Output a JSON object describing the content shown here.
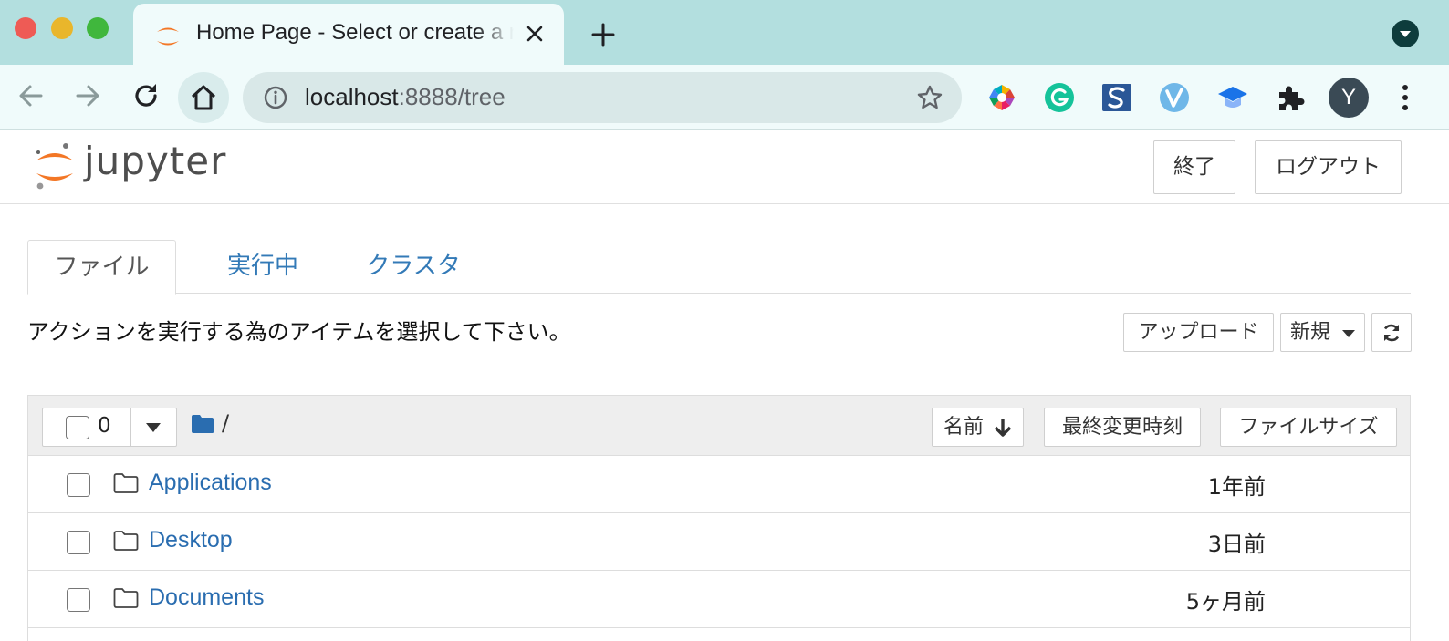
{
  "browser": {
    "tab_title": "Home Page - Select or create a notebook",
    "url_host": "localhost",
    "url_rest": ":8888/tree",
    "avatar_letter": "Y",
    "icons": [
      "back-icon",
      "forward-icon",
      "reload-icon",
      "home-icon",
      "info-icon",
      "bookmark-star-icon",
      "extension-icon",
      "kebab-menu-icon"
    ]
  },
  "header": {
    "logo_text": "jupyter",
    "quit_label": "終了",
    "logout_label": "ログアウト"
  },
  "tabs": [
    {
      "label": "ファイル",
      "active": true
    },
    {
      "label": "実行中",
      "active": false
    },
    {
      "label": "クラスタ",
      "active": false
    }
  ],
  "instructions": "アクションを実行する為のアイテムを選択して下さい。",
  "actions": {
    "upload_label": "アップロード",
    "new_label": "新規"
  },
  "list": {
    "selected_count": "0",
    "breadcrumb": "/",
    "sort_name_label": "名前",
    "sort_modified_label": "最終変更時刻",
    "sort_size_label": "ファイルサイズ",
    "rows": [
      {
        "name": "Applications",
        "modified": "1年前"
      },
      {
        "name": "Desktop",
        "modified": "3日前"
      },
      {
        "name": "Documents",
        "modified": "5ヶ月前"
      }
    ]
  },
  "colors": {
    "tabbar": "#b3dfdf",
    "toolbar": "#f0fbfb",
    "link": "#337ab7",
    "jupyter_orange": "#f37726"
  }
}
